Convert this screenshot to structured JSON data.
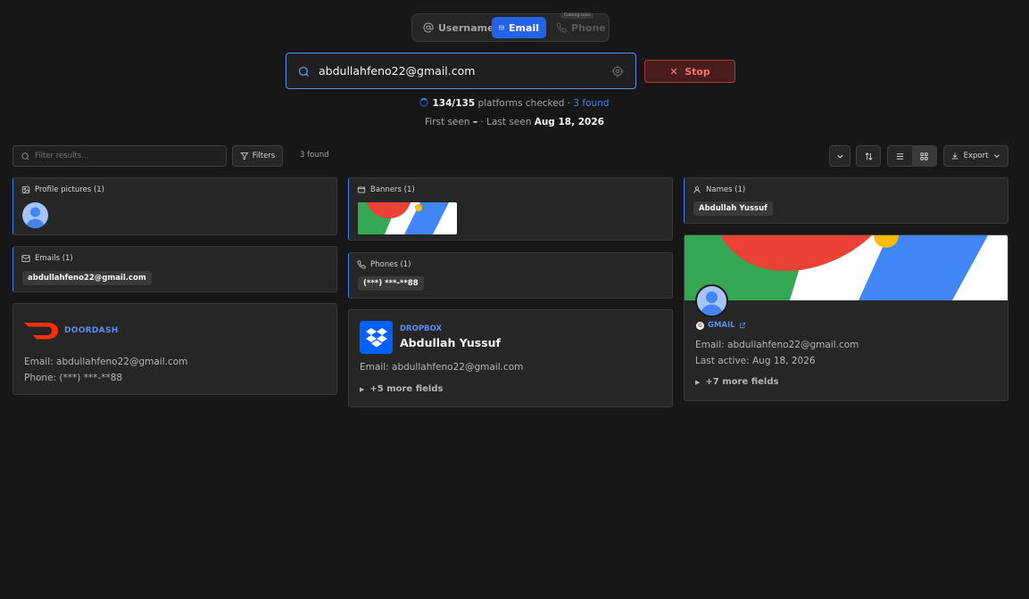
{
  "modes": {
    "username": "Username",
    "email": "Email",
    "phone": "Phone",
    "phone_badge": "Coming soon"
  },
  "search": {
    "value": "abdullahfeno22@gmail.com",
    "stop_label": "Stop"
  },
  "progress": {
    "checked": "134/135",
    "checked_suffix": " platforms checked · ",
    "found": "3 found"
  },
  "seen": {
    "first_label": "First seen ",
    "first_value": "–",
    "last_label": " · Last seen ",
    "last_value": "Aug 18, 2026"
  },
  "toolbar": {
    "filter_placeholder": "Filter results...",
    "filters_label": "Filters",
    "found_count": "3 found",
    "export_label": "Export"
  },
  "summary": {
    "profile_pictures": "Profile pictures (1)",
    "emails": "Emails (1)",
    "email_value": "abdullahfeno22@gmail.com",
    "banners": "Banners (1)",
    "phones": "Phones (1)",
    "phone_value": "(***) ***-**88",
    "names": "Names (1)",
    "name_value": "Abdullah Yussuf"
  },
  "results": {
    "doordash": {
      "platform": "DOORDASH",
      "email": "Email: abdullahfeno22@gmail.com",
      "phone": "Phone: (***) ***-**88"
    },
    "dropbox": {
      "platform": "DROPBOX",
      "name": "Abdullah Yussuf",
      "email": "Email: abdullahfeno22@gmail.com",
      "more": "+5 more fields"
    },
    "gmail": {
      "platform": "GMAIL",
      "email": "Email: abdullahfeno22@gmail.com",
      "last_active": "Last active: Aug 18, 2026",
      "more": "+7 more fields"
    }
  },
  "colors": {
    "background": "#171717",
    "accent": "#2563eb",
    "stop": "#f87171",
    "doordash": "#ff3008",
    "dropbox": "#0061fe"
  }
}
